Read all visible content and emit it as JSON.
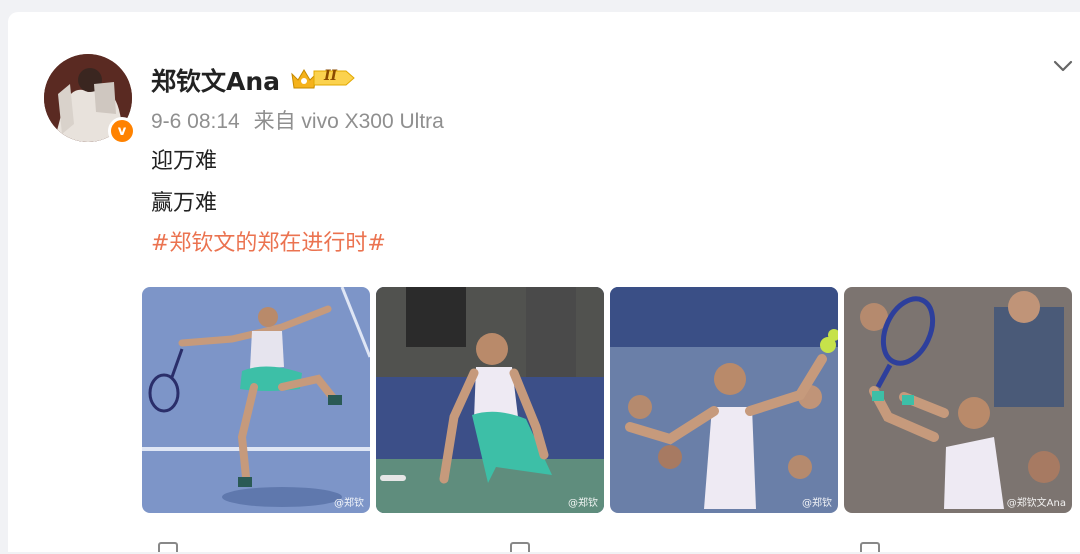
{
  "post": {
    "author": {
      "name": "郑钦文Ana",
      "verified_badge": "v",
      "vip_label": "II",
      "vip_color": "#f5b21b"
    },
    "meta": {
      "time": "9-6 08:14",
      "source": "来自 vivo X300 Ultra"
    },
    "text_lines": [
      "迎万难",
      "赢万难"
    ],
    "topic": "#郑钦文的郑在进行时#",
    "photos": [
      {
        "icon": "tennis-player-serve-photo",
        "watermark": "@郑钦"
      },
      {
        "icon": "tennis-player-kneel-photo",
        "watermark": "@郑钦"
      },
      {
        "icon": "tennis-player-celebrate-photo",
        "watermark": "@郑钦"
      },
      {
        "icon": "tennis-player-racket-photo",
        "watermark": "@郑钦文Ana"
      }
    ],
    "accent_color": "#eb7350",
    "badge_color": "#ff8200"
  }
}
